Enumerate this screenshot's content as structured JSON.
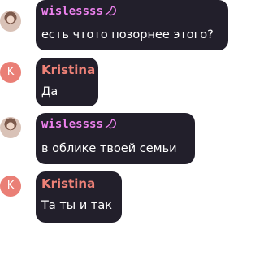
{
  "messages": [
    {
      "author": "wislessss",
      "author_initial": "",
      "avatar": "user-photo-avatar",
      "badge_icon": "pink-leaf-badge-icon",
      "text": "есть чтото позорнее этого?"
    },
    {
      "author": "Kristina",
      "author_initial": "K",
      "avatar": "letter-avatar",
      "badge_icon": "",
      "text": "Да"
    },
    {
      "author": "wislessss",
      "author_initial": "",
      "avatar": "user-photo-avatar",
      "badge_icon": "pink-leaf-badge-icon",
      "text": "в облике твоей семьи"
    },
    {
      "author": "Kristina",
      "author_initial": "K",
      "avatar": "letter-avatar",
      "badge_icon": "",
      "text": "Та ты и так"
    }
  ],
  "colors": {
    "bubble": "#221f2b",
    "name_wislessss": "#ee82ef",
    "name_kristina": "#ee8177",
    "avatar_kristina": "#ea7f76",
    "text": "#ffffff"
  }
}
